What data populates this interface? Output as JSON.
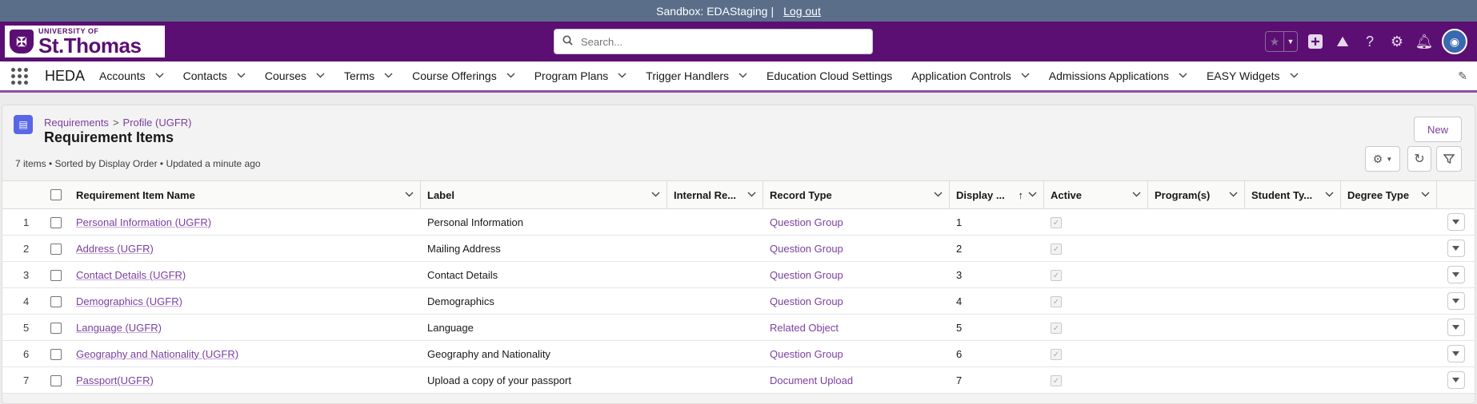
{
  "sandbox": {
    "label": "Sandbox: EDAStaging",
    "separator": "|",
    "logout": "Log out"
  },
  "header": {
    "logo_univ": "UNIVERSITY OF",
    "logo_name": "St.Thomas",
    "search_placeholder": "Search...",
    "icons": [
      "favorites-star-icon",
      "add-icon",
      "trailhead-icon",
      "help-icon",
      "setup-gear-icon",
      "notifications-bell-icon",
      "user-avatar"
    ]
  },
  "nav": {
    "app_name": "HEDA",
    "items": [
      {
        "label": "Accounts",
        "has_menu": true
      },
      {
        "label": "Contacts",
        "has_menu": true
      },
      {
        "label": "Courses",
        "has_menu": true
      },
      {
        "label": "Terms",
        "has_menu": true
      },
      {
        "label": "Course Offerings",
        "has_menu": true
      },
      {
        "label": "Program Plans",
        "has_menu": true
      },
      {
        "label": "Trigger Handlers",
        "has_menu": true
      },
      {
        "label": "Education Cloud Settings",
        "has_menu": false
      },
      {
        "label": "Application Controls",
        "has_menu": true
      },
      {
        "label": "Admissions Applications",
        "has_menu": true
      },
      {
        "label": "EASY Widgets",
        "has_menu": true
      }
    ]
  },
  "list": {
    "breadcrumb": [
      "Requirements",
      "Profile (UGFR)"
    ],
    "breadcrumb_sep": ">",
    "title": "Requirement Items",
    "meta": "7 items • Sorted by Display Order • Updated a minute ago",
    "new_label": "New",
    "columns": [
      "Requirement Item Name",
      "Label",
      "Internal Re...",
      "Record Type",
      "Display ...",
      "Active",
      "Program(s)",
      "Student Ty...",
      "Degree Type"
    ],
    "rows": [
      {
        "n": "1",
        "name": "Personal Information (UGFR)",
        "label": "Personal Information",
        "internal": "",
        "record_type": "Question Group",
        "display": "1",
        "active": true,
        "programs": "",
        "student_type": "",
        "degree_type": ""
      },
      {
        "n": "2",
        "name": "Address (UGFR)",
        "label": "Mailing Address",
        "internal": "",
        "record_type": "Question Group",
        "display": "2",
        "active": true,
        "programs": "",
        "student_type": "",
        "degree_type": ""
      },
      {
        "n": "3",
        "name": "Contact Details (UGFR)",
        "label": "Contact Details",
        "internal": "",
        "record_type": "Question Group",
        "display": "3",
        "active": true,
        "programs": "",
        "student_type": "",
        "degree_type": ""
      },
      {
        "n": "4",
        "name": "Demographics (UGFR)",
        "label": "Demographics",
        "internal": "",
        "record_type": "Question Group",
        "display": "4",
        "active": true,
        "programs": "",
        "student_type": "",
        "degree_type": ""
      },
      {
        "n": "5",
        "name": "Language (UGFR)",
        "label": "Language",
        "internal": "",
        "record_type": "Related Object",
        "display": "5",
        "active": true,
        "programs": "",
        "student_type": "",
        "degree_type": ""
      },
      {
        "n": "6",
        "name": "Geography and Nationality (UGFR)",
        "label": "Geography and Nationality",
        "internal": "",
        "record_type": "Question Group",
        "display": "6",
        "active": true,
        "programs": "",
        "student_type": "",
        "degree_type": ""
      },
      {
        "n": "7",
        "name": "Passport(UGFR)",
        "label": "Upload a copy of your passport",
        "internal": "",
        "record_type": "Document Upload",
        "display": "7",
        "active": true,
        "programs": "",
        "student_type": "",
        "degree_type": ""
      }
    ]
  }
}
